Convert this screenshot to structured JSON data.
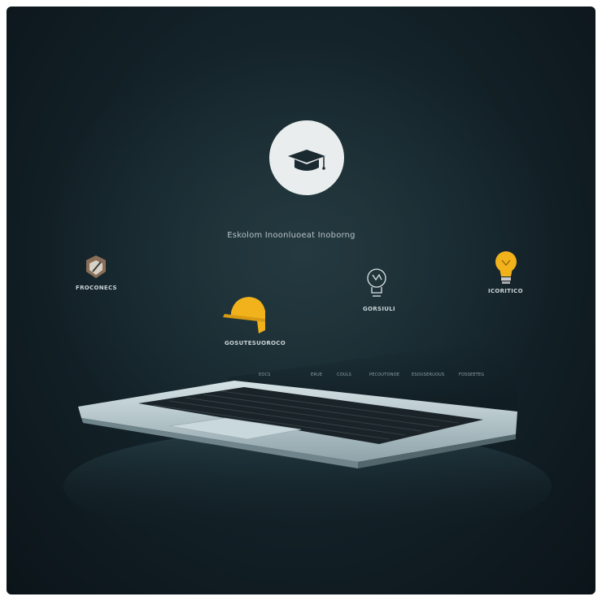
{
  "headline": "Eskolom Inoonluoeat Inoborng",
  "topic_labels": {
    "left": "Froconecs",
    "helmet": "Gosutesuoroco",
    "mind": "Gorsiuli",
    "bulb": "Icoritico"
  },
  "screen_menu": [
    "Eocs",
    "Erue",
    "Couls",
    "Pecoutonoe",
    "Esouseruous",
    "Fosseeteg"
  ],
  "icons": {
    "center": "graduation-cap-icon",
    "left": "pencil-badge-icon",
    "helmet": "hard-hat-icon",
    "mind": "bulb-head-icon",
    "bulb": "light-bulb-icon"
  },
  "colors": {
    "background": "#14232a",
    "accent": "#f2b21c",
    "circle": "#e9edee",
    "laptop": "#b9cbd0"
  }
}
